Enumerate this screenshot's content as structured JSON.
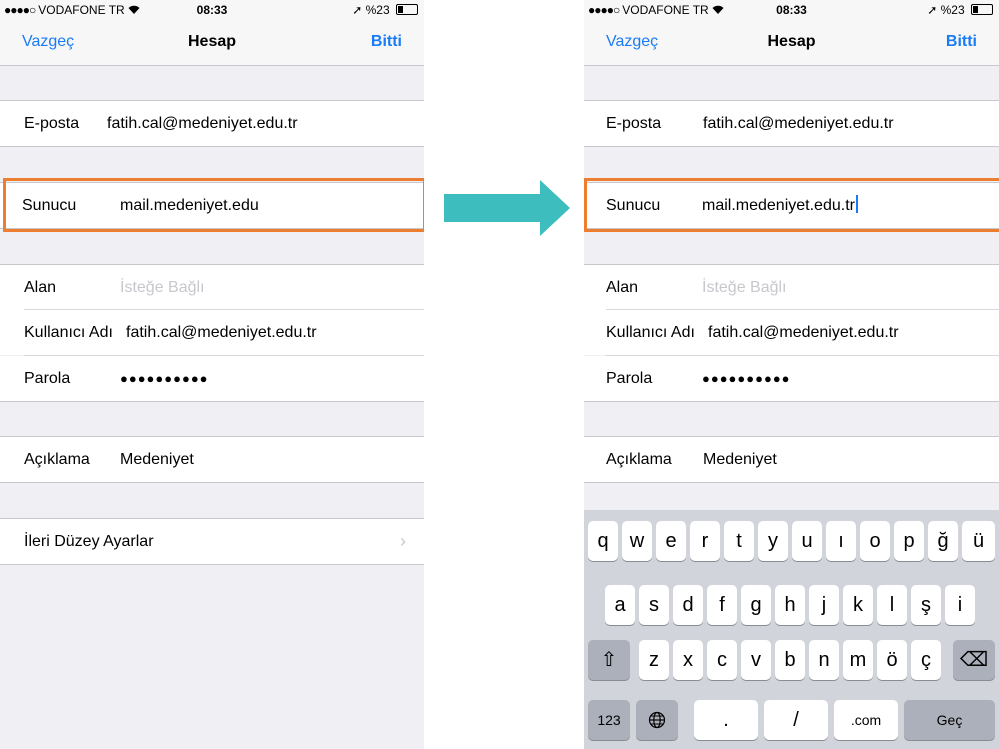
{
  "status_bar": {
    "dots": "●●●●○",
    "carrier": "VODAFONE TR",
    "wifi_icon": "wifi",
    "time": "08:33",
    "location_icon": "➚",
    "battery": "%23",
    "battery_level": 0.23
  },
  "nav": {
    "cancel_label": "Vazgeç",
    "title": "Hesap",
    "done_label": "Bitti"
  },
  "form": {
    "email": {
      "label": "E-posta",
      "value": "fatih.cal@medeniyet.edu.tr"
    },
    "server": {
      "label": "Sunucu",
      "value_before": "mail.medeniyet.edu",
      "value_after": "mail.medeniyet.edu.tr"
    },
    "domain": {
      "label": "Alan",
      "placeholder": "İsteğe Bağlı"
    },
    "username": {
      "label": "Kullanıcı Adı",
      "value": "fatih.cal@medeniyet.edu.tr"
    },
    "password": {
      "label": "Parola",
      "value": "●●●●●●●●●●"
    },
    "description": {
      "label": "Açıklama",
      "value": "Medeniyet"
    },
    "advanced": {
      "label": "İleri Düzey Ayarlar",
      "chevron": "›"
    }
  },
  "highlight_color": "#ed7d31",
  "arrow_color": "#3dbdbd",
  "keyboard": {
    "row1": [
      "q",
      "w",
      "e",
      "r",
      "t",
      "y",
      "u",
      "ı",
      "o",
      "p",
      "ğ",
      "ü"
    ],
    "row2": [
      "a",
      "s",
      "d",
      "f",
      "g",
      "h",
      "j",
      "k",
      "l",
      "ş",
      "i"
    ],
    "row3": [
      "z",
      "x",
      "c",
      "v",
      "b",
      "n",
      "m",
      "ö",
      "ç"
    ],
    "shift_icon": "⇧",
    "backspace_icon": "⌫",
    "globe_icon": "🌐",
    "numbers_label": "123",
    "dot_label": ".",
    "slash_label": "/",
    "com_label": ".com",
    "go_label": "Geç"
  }
}
